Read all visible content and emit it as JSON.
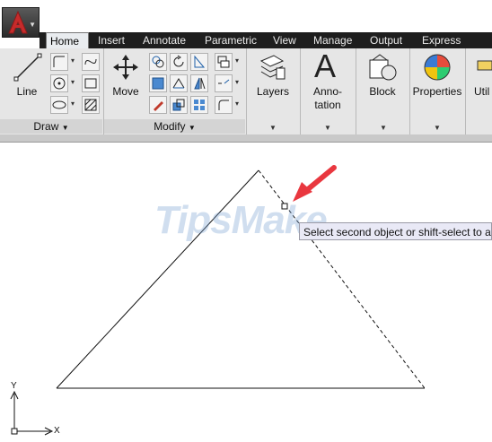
{
  "tabs": [
    {
      "label": "Home",
      "active": true
    },
    {
      "label": "Insert"
    },
    {
      "label": "Annotate"
    },
    {
      "label": "Parametric"
    },
    {
      "label": "View"
    },
    {
      "label": "Manage"
    },
    {
      "label": "Output"
    },
    {
      "label": "Express Tools"
    }
  ],
  "ribbon": {
    "draw": {
      "panel_label": "Draw",
      "line_label": "Line"
    },
    "modify": {
      "panel_label": "Modify",
      "move_label": "Move"
    },
    "layers_label": "Layers",
    "annotation_label_1": "Anno-",
    "annotation_label_2": "tation",
    "annotation_glyph": "A",
    "block_label": "Block",
    "properties_label": "Properties",
    "utilities_label": "Util"
  },
  "canvas": {
    "tooltip": "Select second object or shift-select to ap",
    "watermark": "TipsMake",
    "ucs": {
      "x_label": "X",
      "y_label": "Y"
    }
  },
  "colors": {
    "tabstrip_bg": "#1e1e1e",
    "ribbon_bg": "#e6e6e6",
    "app_logo_red": "#c62b2b",
    "arrow_red": "#e9373f"
  }
}
